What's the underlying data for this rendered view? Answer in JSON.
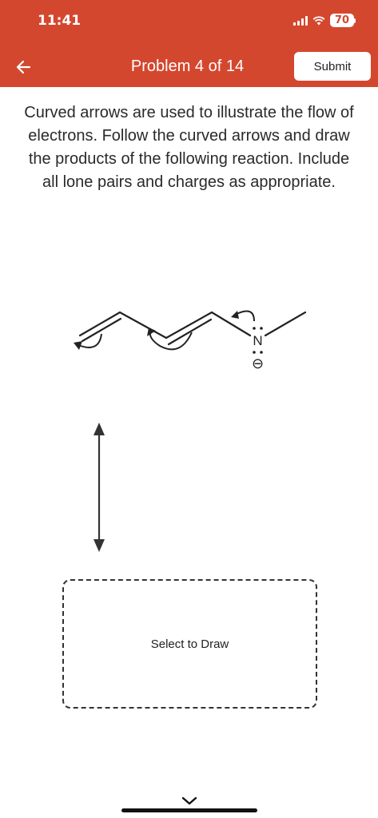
{
  "status_bar": {
    "time": "11:41",
    "battery": "70"
  },
  "header": {
    "title": "Problem 4 of 14",
    "submit_label": "Submit",
    "back_icon": "arrow-left-icon",
    "background_color": "#d4472f"
  },
  "question": {
    "instructions": "Curved arrows are used to illustrate the flow of electrons. Follow the curved arrows and draw the products of the following reaction. Include all lone pairs and charges as appropriate."
  },
  "molecule": {
    "atom_label": "N",
    "charge_symbol": "⊖"
  },
  "answer": {
    "draw_label": "Select to Draw"
  }
}
